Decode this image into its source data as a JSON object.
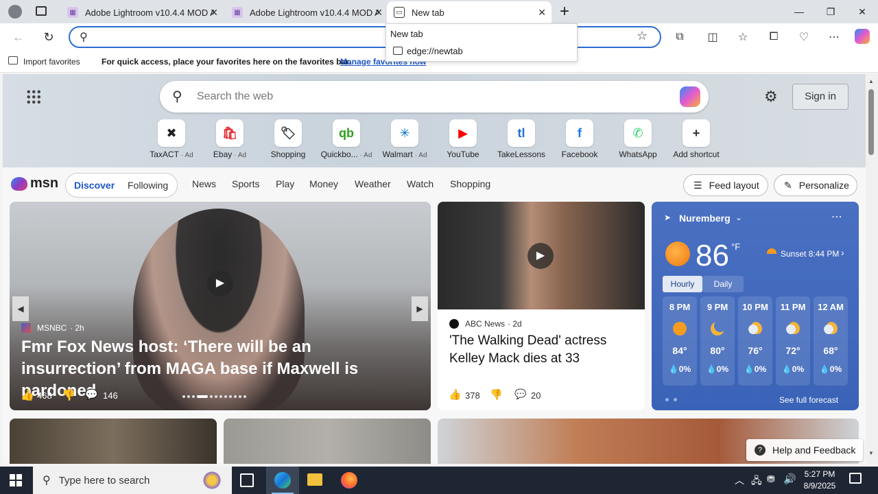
{
  "browser": {
    "tabs": [
      {
        "label": "Adobe Lightroom v10.4.4 MOD A",
        "icon": "page-icon"
      },
      {
        "label": "Adobe Lightroom v10.4.4 MOD A",
        "icon": "page-icon"
      },
      {
        "label": "New tab",
        "icon": "newtab-icon"
      }
    ],
    "new_tab_symbol": "+",
    "window": {
      "minimize": "—",
      "restore": "❐",
      "close": "✕"
    },
    "address": {
      "value": "",
      "placeholder": ""
    },
    "dropdown": {
      "title": "New tab",
      "url": "edge://newtab"
    },
    "favbar": {
      "import_label": "Import favorites",
      "message": "For quick access, place your favorites here on the favorites bar.",
      "manage_link": "Manage favorites now"
    }
  },
  "ntp": {
    "search_placeholder": "Search the web",
    "sign_in": "Sign in",
    "shortcuts": [
      {
        "label": "TaxACT",
        "ad": "· Ad",
        "glyph": "✖",
        "color": "#1e1e1e"
      },
      {
        "label": "Ebay",
        "ad": "· Ad",
        "glyph": "🛍",
        "color": "#e53238"
      },
      {
        "label": "Shopping",
        "ad": "",
        "glyph": "🏷",
        "color": "#333333"
      },
      {
        "label": "Quickbo...",
        "ad": "· Ad",
        "glyph": "qb",
        "color": "#2ca01c"
      },
      {
        "label": "Walmart",
        "ad": "· Ad",
        "glyph": "✳",
        "color": "#0071ce"
      },
      {
        "label": "YouTube",
        "ad": "",
        "glyph": "▶",
        "color": "#ff0000"
      },
      {
        "label": "TakeLessons",
        "ad": "",
        "glyph": "tl",
        "color": "#1f6fd1"
      },
      {
        "label": "Facebook",
        "ad": "",
        "glyph": "f",
        "color": "#1877f2"
      },
      {
        "label": "WhatsApp",
        "ad": "",
        "glyph": "✆",
        "color": "#25d366"
      },
      {
        "label": "Add shortcut",
        "ad": "",
        "glyph": "+",
        "color": "#333333"
      }
    ],
    "msn": {
      "logo": "msn",
      "tabs": [
        "Discover",
        "Following"
      ],
      "nav": [
        "News",
        "Sports",
        "Play",
        "Money",
        "Weather",
        "Watch",
        "Shopping"
      ],
      "feed_layout": "Feed layout",
      "personalize": "Personalize"
    },
    "card_main": {
      "source": "MSNBC",
      "age": "· 2h",
      "headline": "Fmr Fox News host: ‘There will be an insurrection’ from MAGA base if Maxwell is pardoned",
      "likes": "468",
      "comments": "146"
    },
    "card_side": {
      "source": "ABC News",
      "age": "· 2d",
      "headline": "'The Walking Dead' actress Kelley Mack dies at 33",
      "likes": "378",
      "comments": "20"
    },
    "weather": {
      "location": "Nuremberg",
      "temp": "86",
      "unit": "°F",
      "sunset": "Sunset 8:44 PM",
      "tabs": [
        "Hourly",
        "Daily"
      ],
      "hours": [
        {
          "time": "8 PM",
          "temp": "84°",
          "precip": "💧0%",
          "icon": "sun"
        },
        {
          "time": "9 PM",
          "temp": "80°",
          "precip": "💧0%",
          "icon": "moon"
        },
        {
          "time": "10 PM",
          "temp": "76°",
          "precip": "💧0%",
          "icon": "partly-cloudy-night"
        },
        {
          "time": "11 PM",
          "temp": "72°",
          "precip": "💧0%",
          "icon": "partly-cloudy-night"
        },
        {
          "time": "12 AM",
          "temp": "68°",
          "precip": "💧0%",
          "icon": "partly-cloudy-night"
        }
      ],
      "see_forecast": "See full forecast"
    },
    "help": "Help and Feedback"
  },
  "taskbar": {
    "search_placeholder": "Type here to search",
    "time": "5:27 PM",
    "date": "8/9/2025"
  },
  "colors": {
    "accent": "#2b6cd4",
    "weather_bg": "#3f68bb",
    "taskbar_bg": "#1f2633"
  }
}
